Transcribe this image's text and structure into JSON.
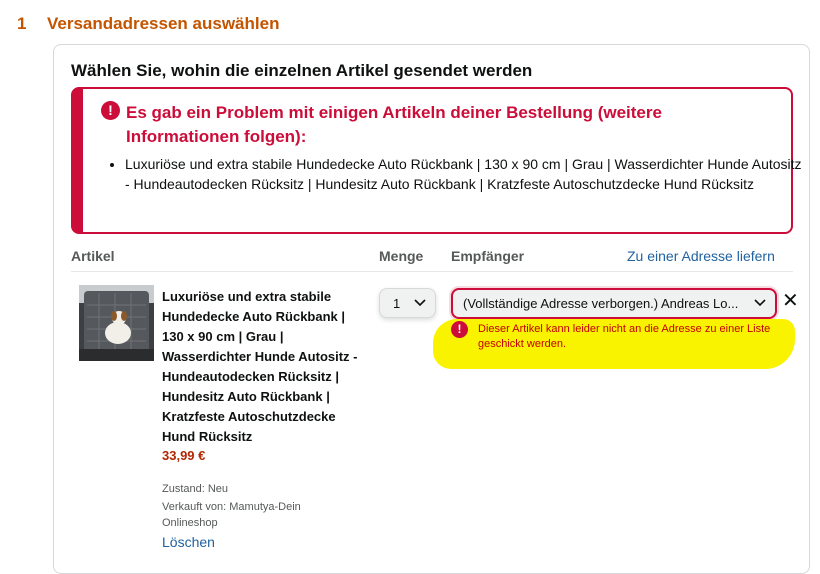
{
  "step": {
    "number": "1",
    "title": "Versandadressen auswählen"
  },
  "card": {
    "title": "Wählen Sie, wohin die einzelnen Artikel gesendet werden"
  },
  "alert": {
    "icon": "!",
    "heading": "Es gab ein Problem mit einigen Artikeln deiner Bestellung (weitere Informationen folgen):",
    "items": [
      "Luxuriöse und extra stabile Hundedecke Auto Rückbank | 130 x 90 cm | Grau | Wasserdichter Hunde Autositz - Hundeautodecken Rücksitz | Hundesitz Auto Rückbank | Kratzfeste Autoschutzdecke Hund Rücksitz"
    ]
  },
  "table": {
    "col_item": "Artikel",
    "col_qty": "Menge",
    "col_recipient": "Empfänger",
    "ship_one_address_link": "Zu einer Adresse liefern"
  },
  "item": {
    "title": "Luxuriöse und extra stabile Hundedecke Auto Rückbank | 130 x 90 cm | Grau | Wasserdichter Hunde Autositz - Hundeautodecken Rücksitz | Hundesitz Auto Rückbank | Kratzfeste Autoschutzdecke Hund Rücksitz",
    "price": "33,99 €",
    "condition": "Zustand: Neu",
    "seller": "Verkauft von: Mamutya-Dein Onlineshop",
    "delete_label": "Löschen",
    "quantity": "1",
    "address": "(Vollständige Adresse verborgen.) Andreas Lo...",
    "remove_symbol": "✕",
    "error_icon": "!",
    "error_message": "Dieser Artikel kann leider nicht an die Adresse zu einer Liste geschickt werden."
  },
  "icons": {
    "chevron": "chevron-down-icon",
    "alert": "exclamation-circle-icon",
    "close": "close-icon"
  },
  "colors": {
    "accent": "#c45500",
    "error": "#cc0c39",
    "link": "#2162a1",
    "price": "#b12704",
    "highlight": "#f9f300"
  }
}
